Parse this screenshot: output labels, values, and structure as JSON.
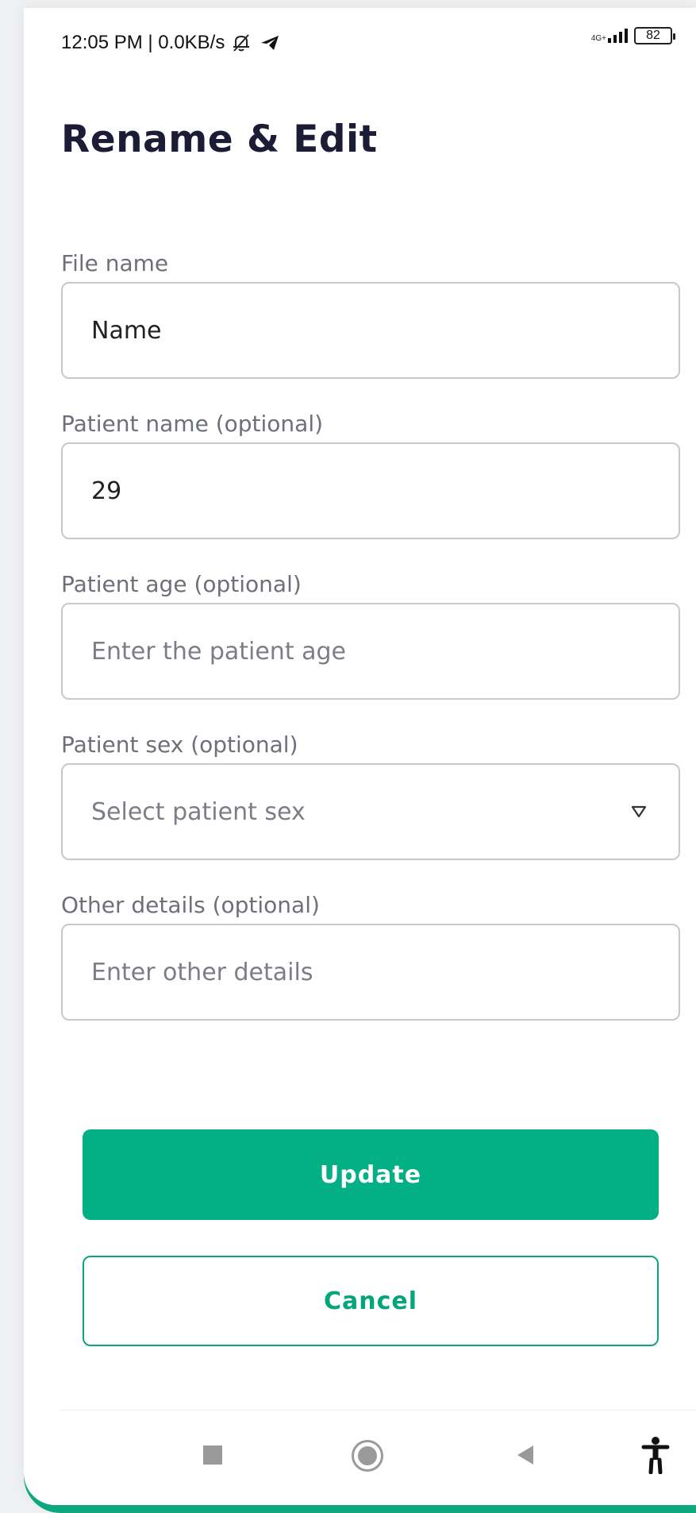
{
  "status_bar": {
    "time_net": "12:05 PM | 0.0KB/s",
    "network_type": "4G+",
    "battery": "82"
  },
  "page": {
    "title": "Rename & Edit"
  },
  "fields": {
    "file_name": {
      "label": "File name",
      "value": "Name"
    },
    "patient_name": {
      "label": "Patient name (optional)",
      "value": "29"
    },
    "patient_age": {
      "label": "Patient age (optional)",
      "placeholder": "Enter the patient age"
    },
    "patient_sex": {
      "label": "Patient sex (optional)",
      "placeholder": "Select patient sex"
    },
    "other_details": {
      "label": "Other details (optional)",
      "placeholder": "Enter other details"
    }
  },
  "buttons": {
    "update": "Update",
    "cancel": "Cancel"
  },
  "colors": {
    "primary": "#03af84",
    "title": "#1c1c36",
    "label": "#6e7079",
    "border": "#c7c8cf"
  },
  "icons": {
    "mute": "bell-off-icon",
    "telegram": "telegram-icon",
    "signal": "signal-icon",
    "battery": "battery-icon",
    "dropdown": "triangle-down-icon",
    "nav_recent": "square-icon",
    "nav_home": "circle-icon",
    "nav_back": "back-triangle-icon",
    "accessibility": "accessibility-icon"
  }
}
